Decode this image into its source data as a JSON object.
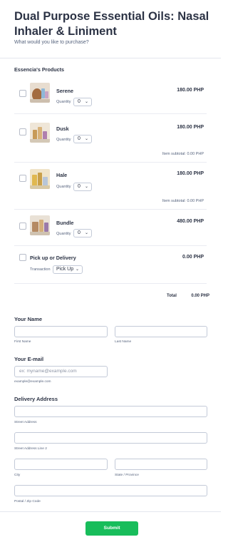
{
  "form": {
    "title": "Dual Purpose Essential Oils: Nasal Inhaler & Liniment",
    "subtitle": "What would you like to purchase?"
  },
  "products_section": {
    "label": "Essencia's Products",
    "quantity_label": "Quantity",
    "items": [
      {
        "name": "Serene",
        "price": "180.00 PHP",
        "quantity": "0",
        "subtotal": null
      },
      {
        "name": "Dusk",
        "price": "180.00 PHP",
        "quantity": "0",
        "subtotal": "Item subtotal:   0.00 PHP"
      },
      {
        "name": "Hale",
        "price": "180.00 PHP",
        "quantity": "0",
        "subtotal": "Item subtotal:   0.00 PHP"
      },
      {
        "name": "Bundle",
        "price": "480.00 PHP",
        "quantity": "0",
        "subtotal": null
      }
    ],
    "pickup": {
      "name": "Pick up or Delivery",
      "price": "0.00 PHP",
      "transaction_label": "Transaction",
      "transaction_value": "Pick Up"
    },
    "total_label": "Total",
    "total_value": "0.00 PHP"
  },
  "name_field": {
    "label": "Your Name",
    "first_sublabel": "First Name",
    "last_sublabel": "Last Name"
  },
  "email_field": {
    "label": "Your E-mail",
    "placeholder": "ex: myname@example.com",
    "sublabel": "example@example.com"
  },
  "address_field": {
    "label": "Delivery Address",
    "street_sublabel": "Street Address",
    "street2_sublabel": "Street Address Line 2",
    "city_sublabel": "City",
    "state_sublabel": "State / Province",
    "postal_sublabel": "Postal / Zip Code"
  },
  "submit_label": "Submit",
  "colors": {
    "submit": "#18bd5b",
    "text": "#2c3345",
    "muted": "#57647e",
    "border": "#c3cad8"
  }
}
